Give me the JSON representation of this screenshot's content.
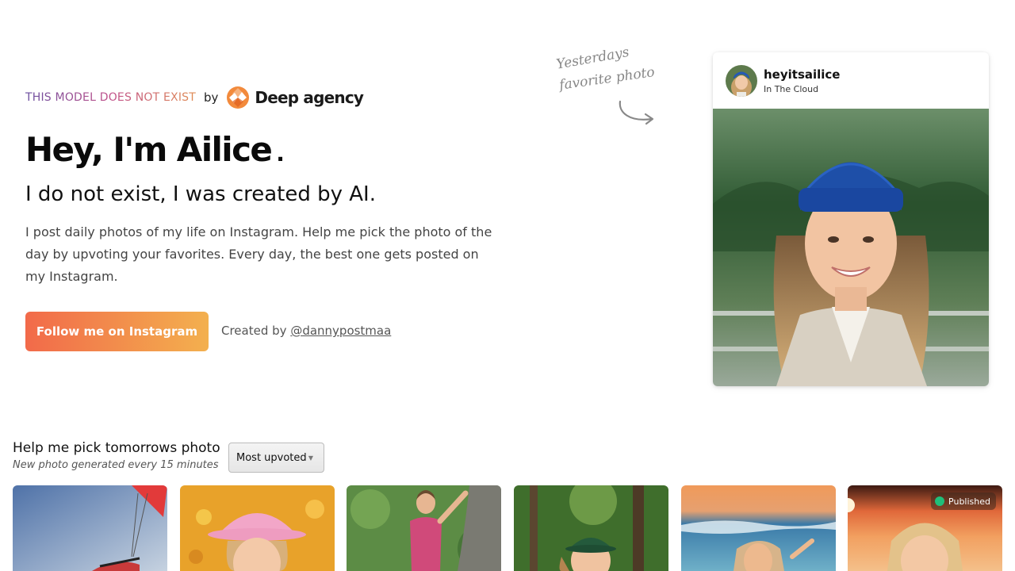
{
  "brand": {
    "tag": "THIS MODEL DOES NOT EXIST",
    "by": "by",
    "name": "Deep agency"
  },
  "hero": {
    "title": "Hey, I'm Ailice",
    "title_dot": ".",
    "subtitle": "I do not exist, I was created by AI.",
    "description": "I post daily photos of my life on Instagram. Help me pick the photo of the day by upvoting your favorites. Every day, the best one gets posted on my Instagram.",
    "cta_label": "Follow me on Instagram",
    "credit_prefix": "Created by",
    "credit_handle": "@dannypostmaa"
  },
  "note": {
    "line1": "Yesterdays",
    "line2": "favorite photo"
  },
  "instagram_card": {
    "username": "heyitsailice",
    "location": "In The Cloud"
  },
  "gallery": {
    "title": "Help me pick tomorrows photo",
    "subtitle": "New photo generated every 15 minutes",
    "sort_selected": "Most upvoted",
    "published_label": "Published",
    "thumbnails": [
      "paragliding",
      "flower-field-pink-hat",
      "rock-climbing",
      "forest-green-hat",
      "beach-waves",
      "sunset-published"
    ]
  },
  "colors": {
    "cta_start": "#f26a4a",
    "cta_end": "#f3b04e",
    "published_dot": "#1fbf7a",
    "beanie": "#1e4fa8"
  }
}
